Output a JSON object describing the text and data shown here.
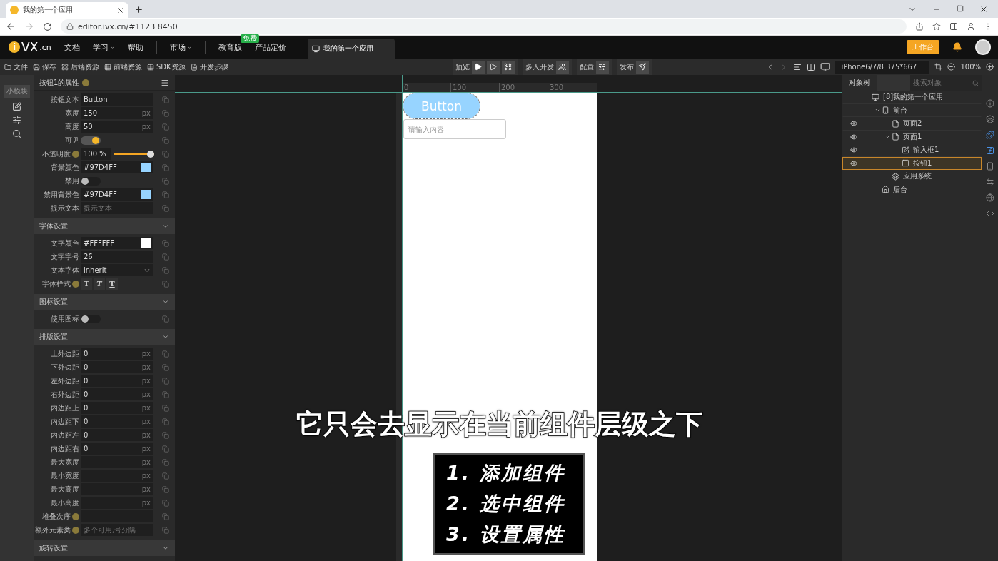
{
  "browser": {
    "tab_title": "我的第一个应用",
    "url": "editor.ivx.cn/#1123 8450"
  },
  "header": {
    "logo": "i",
    "logo_text": "VX",
    "logo_suffix": ".cn",
    "nav": [
      {
        "label": "文档",
        "caret": false,
        "sep": false
      },
      {
        "label": "学习",
        "caret": true,
        "sep": false
      },
      {
        "label": "帮助",
        "caret": false,
        "sep": false
      },
      {
        "label": "市场",
        "caret": true,
        "sep": true
      },
      {
        "label": "教育版",
        "caret": false,
        "badge": "免费",
        "sep": true
      },
      {
        "label": "产品定价",
        "caret": false,
        "sep": false
      }
    ],
    "app_tab": "我的第一个应用",
    "workbench": "工作台"
  },
  "toolbar": {
    "items": [
      {
        "kind": "folder",
        "label": "文件"
      },
      {
        "kind": "save",
        "label": "保存"
      },
      {
        "kind": "grid",
        "label": "后端资源"
      },
      {
        "kind": "tiles",
        "label": "前端资源"
      },
      {
        "kind": "table",
        "label": "SDK资源"
      },
      {
        "kind": "doc",
        "label": "开发步骤"
      }
    ],
    "groups": [
      {
        "kind": "preview",
        "label": "预览"
      },
      {
        "kind": "team",
        "label": "多人开发"
      },
      {
        "kind": "config",
        "label": "配置"
      },
      {
        "kind": "publish",
        "label": "发布"
      }
    ],
    "device": "iPhone6/7/8 375*667",
    "zoom": "100%"
  },
  "left_strip": {
    "label": "小模块"
  },
  "props": {
    "title": "按钮1的属性",
    "sections": [
      {
        "rows": [
          {
            "kind": "text",
            "label": "按钮文本",
            "value": "Button"
          },
          {
            "kind": "text",
            "label": "宽度",
            "value": "150",
            "unit": "px"
          },
          {
            "kind": "text",
            "label": "高度",
            "value": "50",
            "unit": "px"
          },
          {
            "kind": "toggle",
            "label": "可见",
            "on": true
          },
          {
            "kind": "slider",
            "label": "不透明度",
            "help": true,
            "value": "100 %",
            "level": 1
          },
          {
            "kind": "color",
            "label": "背景颜色",
            "value": "#97D4FF"
          },
          {
            "kind": "toggle",
            "label": "禁用",
            "on": false
          },
          {
            "kind": "color",
            "label": "禁用背景色",
            "value": "#97D4FF"
          },
          {
            "kind": "text",
            "label": "提示文本",
            "placeholder": "提示文本"
          }
        ]
      },
      {
        "title": "字体设置",
        "rows": [
          {
            "kind": "color",
            "label": "文字颜色",
            "value": "#FFFFFF"
          },
          {
            "kind": "text",
            "label": "文字字号",
            "value": "26"
          },
          {
            "kind": "select",
            "label": "文本字体",
            "value": "inherit"
          },
          {
            "kind": "styles",
            "label": "字体样式",
            "help": true,
            "glyphs": [
              "T",
              "T",
              "T"
            ]
          }
        ]
      },
      {
        "title": "图标设置",
        "rows": [
          {
            "kind": "toggle",
            "label": "使用图标",
            "on": false
          }
        ]
      },
      {
        "title": "排版设置",
        "rows": [
          {
            "kind": "text",
            "label": "上外边距",
            "value": "0",
            "unit": "px"
          },
          {
            "kind": "text",
            "label": "下外边距",
            "value": "0",
            "unit": "px"
          },
          {
            "kind": "text",
            "label": "左外边距",
            "value": "0",
            "unit": "px"
          },
          {
            "kind": "text",
            "label": "右外边距",
            "value": "0",
            "unit": "px"
          },
          {
            "kind": "text",
            "label": "内边距上",
            "value": "0",
            "unit": "px"
          },
          {
            "kind": "text",
            "label": "内边距下",
            "value": "0",
            "unit": "px"
          },
          {
            "kind": "text",
            "label": "内边距左",
            "value": "0",
            "unit": "px"
          },
          {
            "kind": "text",
            "label": "内边距右",
            "value": "0",
            "unit": "px"
          },
          {
            "kind": "text",
            "label": "最大宽度",
            "unit": "px"
          },
          {
            "kind": "text",
            "label": "最小宽度",
            "unit": "px"
          },
          {
            "kind": "text",
            "label": "最大高度",
            "unit": "px"
          },
          {
            "kind": "text",
            "label": "最小高度",
            "unit": "px"
          },
          {
            "kind": "text",
            "label": "堆叠次序",
            "help": true
          },
          {
            "kind": "text",
            "label": "额外元素类",
            "help": true,
            "placeholder": "多个可用,号分隔"
          }
        ]
      },
      {
        "title": "旋转设置"
      }
    ]
  },
  "canvas": {
    "ruler": [
      "0",
      "100",
      "200",
      "300"
    ],
    "button": "Button",
    "input_placeholder": "请输入内容"
  },
  "tree": {
    "tab": "对象树",
    "search_placeholder": "搜索对象",
    "nodes": [
      {
        "kind": "app",
        "label": "[8]我的第一个应用",
        "eye": false,
        "selected": false,
        "children": [
          {
            "kind": "phone",
            "label": "前台",
            "eye": false,
            "selected": false,
            "expanded": true,
            "children": [
              {
                "kind": "page",
                "label": "页面2",
                "eye": true,
                "selected": false
              },
              {
                "kind": "page",
                "label": "页面1",
                "eye": true,
                "selected": false,
                "expanded": true,
                "children": [
                  {
                    "kind": "input",
                    "label": "输入框1",
                    "eye": true,
                    "selected": false
                  },
                  {
                    "kind": "button",
                    "label": "按钮1",
                    "eye": true,
                    "selected": true
                  }
                ]
              },
              {
                "kind": "gear",
                "label": "应用系统",
                "eye": false,
                "selected": false
              }
            ]
          },
          {
            "kind": "home",
            "label": "后台",
            "eye": false,
            "selected": false
          }
        ]
      }
    ]
  },
  "subtitle": "它只会去显示在当前组件层级之下",
  "steps": [
    "1. 添加组件",
    "2. 选中组件",
    "3. 设置属性"
  ]
}
